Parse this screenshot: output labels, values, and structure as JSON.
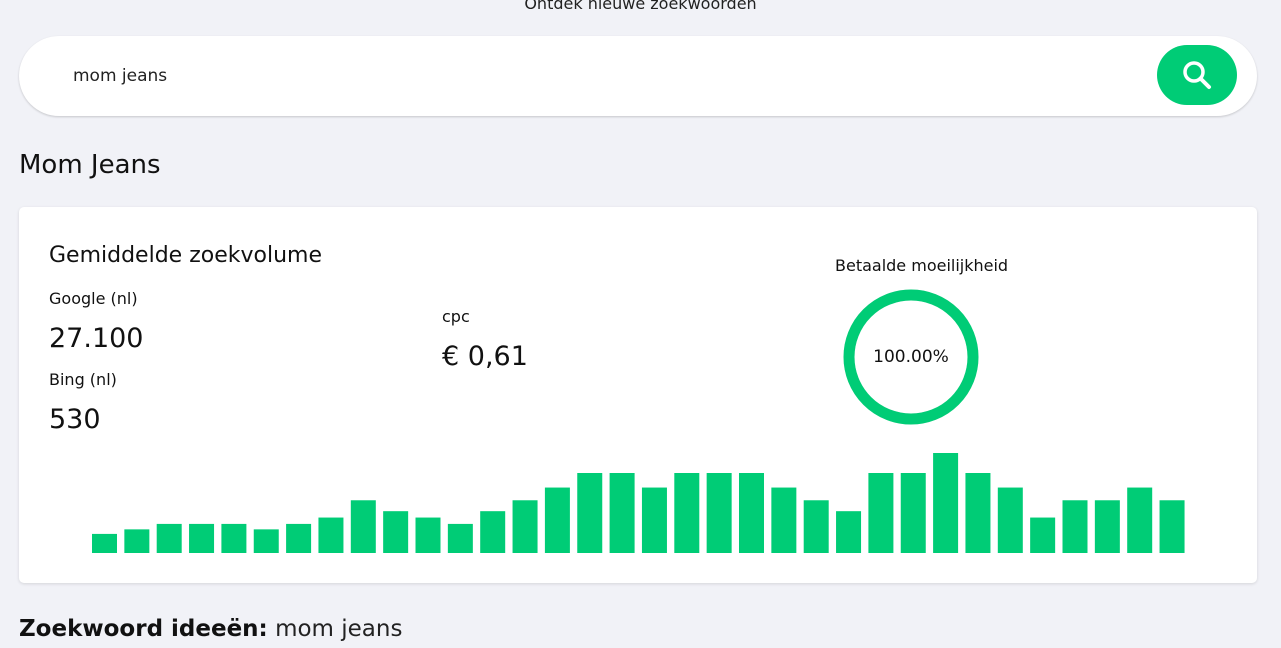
{
  "header": {
    "title": "Ontdek nieuwe zoekwoorden"
  },
  "search": {
    "value": "mom jeans",
    "placeholder": ""
  },
  "keyword": {
    "title": "Mom Jeans"
  },
  "metrics": {
    "volume_heading": "Gemiddelde zoekvolume",
    "google_label": "Google (nl)",
    "google_value": "27.100",
    "bing_label": "Bing (nl)",
    "bing_value": "530",
    "cpc_label": "cpc",
    "cpc_value": "€ 0,61",
    "difficulty_label": "Betaalde moeilijkheid",
    "difficulty_value": "100.00%",
    "difficulty_fraction": 1.0
  },
  "colors": {
    "accent": "#00cc76",
    "background": "#f1f2f7"
  },
  "chart_data": {
    "type": "bar",
    "values": [
      2.1,
      2.6,
      3.2,
      3.2,
      3.2,
      2.6,
      3.2,
      3.9,
      5.8,
      4.6,
      3.9,
      3.2,
      4.6,
      5.8,
      7.2,
      8.8,
      8.8,
      7.2,
      8.8,
      8.8,
      8.8,
      7.2,
      5.8,
      4.6,
      8.8,
      8.8,
      11.0,
      8.8,
      7.2,
      3.9,
      5.8,
      5.8,
      7.2,
      5.8
    ],
    "color": "#00cc76",
    "axes_visible": false,
    "grid": false
  },
  "ideas": {
    "label": "Zoekwoord ideeën:",
    "keyword": "mom jeans"
  }
}
